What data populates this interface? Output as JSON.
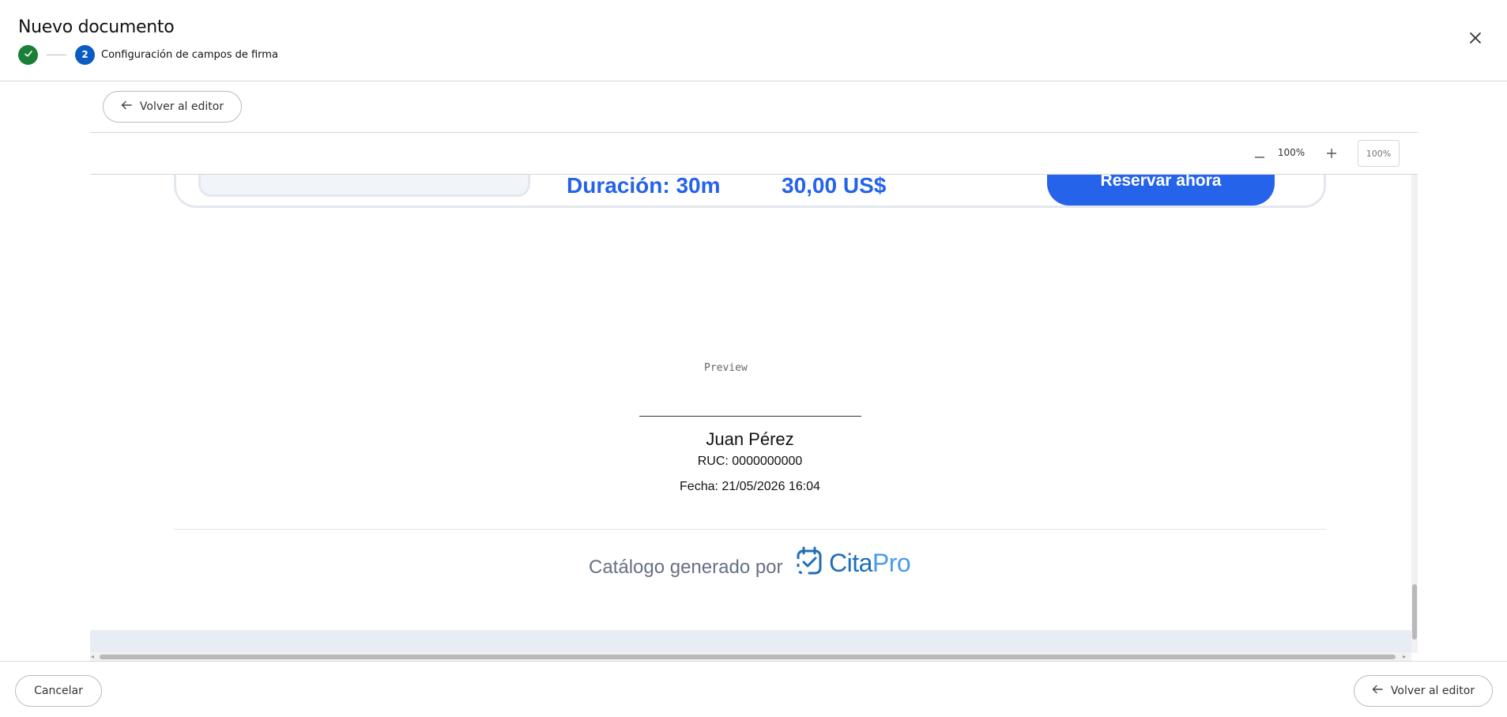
{
  "header": {
    "title": "Nuevo documento",
    "step_done_icon": "check-icon",
    "step_active_number": "2",
    "step_active_label": "Configuración de campos de firma",
    "close_icon": "close-icon"
  },
  "toolbar": {
    "back_label": "Volver al editor",
    "zoom": {
      "minus_label": "−",
      "value": "100%",
      "plus_label": "+",
      "input_placeholder": "100%"
    }
  },
  "document": {
    "duration": "Duración: 30m",
    "price": "30,00 US$",
    "reserve_button": "Reservar ahora",
    "preview_label": "Preview",
    "signer_name": "Juan Pérez",
    "signer_ruc": "RUC: 0000000000",
    "signer_date": "Fecha: 21/05/2026 16:04",
    "generated_by": "Catálogo generado por",
    "logo_cita": "Cita",
    "logo_pro": "Pro"
  },
  "footer": {
    "cancel_label": "Cancelar",
    "back_label": "Volver al editor"
  },
  "colors": {
    "accent_blue": "#2563eb",
    "step_done": "#1a7f37",
    "step_active": "#0a5cc2"
  }
}
